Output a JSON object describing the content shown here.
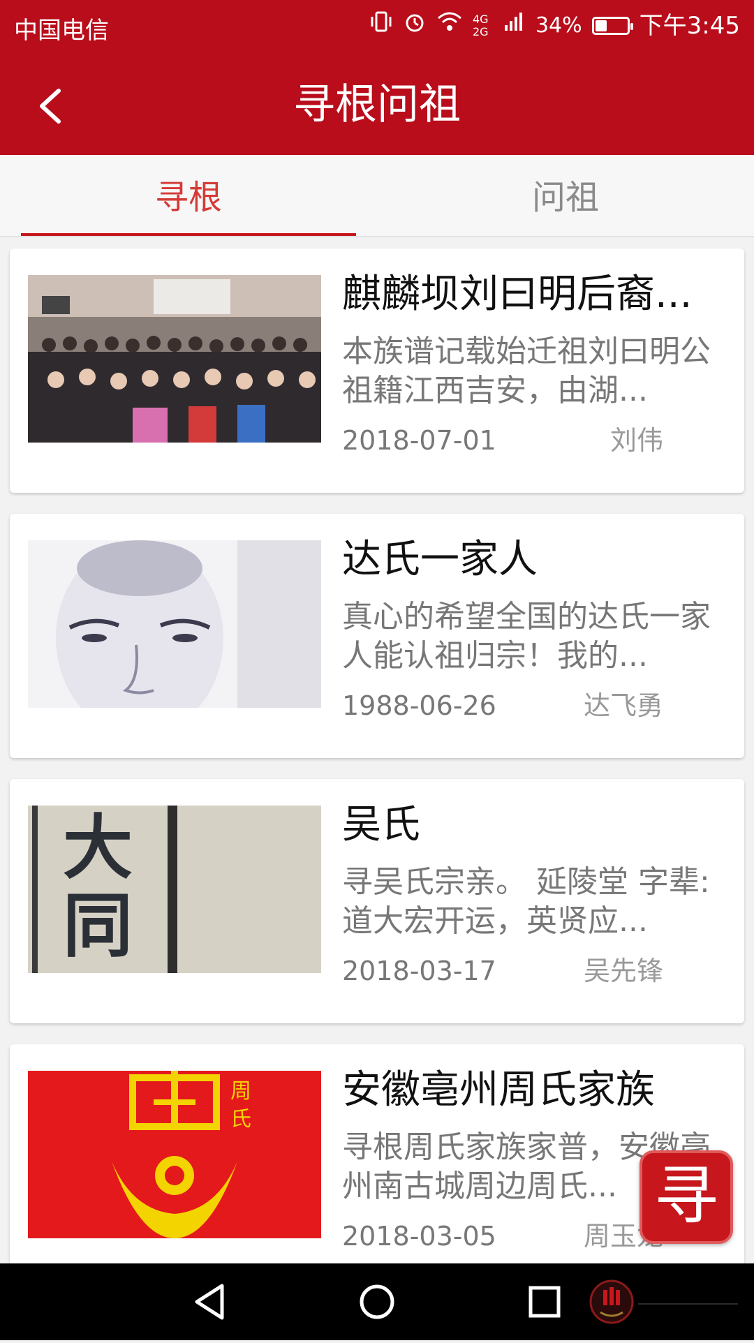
{
  "status": {
    "carrier": "中国电信",
    "battery": "34%",
    "battery_level": 0.34,
    "time": "下午3:45",
    "network": "4G 2G"
  },
  "nav": {
    "title": "寻根问祖"
  },
  "tabs": [
    {
      "label": "寻根",
      "active": true
    },
    {
      "label": "问祖",
      "active": false
    }
  ],
  "posts": [
    {
      "title": "麒麟坝刘曰明后裔...",
      "desc": "本族谱记载始迁祖刘曰明公祖籍江西吉安，由湖...",
      "date": "2018-07-01",
      "author": "刘伟"
    },
    {
      "title": "达氏一家人",
      "desc": "真心的希望全国的达氏一家人能认祖归宗！我的...",
      "date": "1988-06-26",
      "author": "达飞勇"
    },
    {
      "title": "吴氏",
      "desc": "寻吴氏宗亲。 延陵堂 字辈: 道大宏开运，英贤应...",
      "date": "2018-03-17",
      "author": "吴先锋"
    },
    {
      "title": "安徽亳州周氏家族",
      "desc": "寻根周氏家族家普，安徽亳州南古城周边周氏...",
      "date": "2018-03-05",
      "author": "周玉龙"
    }
  ],
  "thumbs": {
    "calligraphy": "大同",
    "seal_side": "周氏"
  },
  "fab": {
    "label": "寻"
  },
  "colors": {
    "brand": "#b90d1b",
    "tab_active": "#d43a36"
  },
  "icons": {
    "back": "chevron-left-icon",
    "home": "circle-icon",
    "recent": "square-icon",
    "nav_back": "triangle-left-icon"
  }
}
